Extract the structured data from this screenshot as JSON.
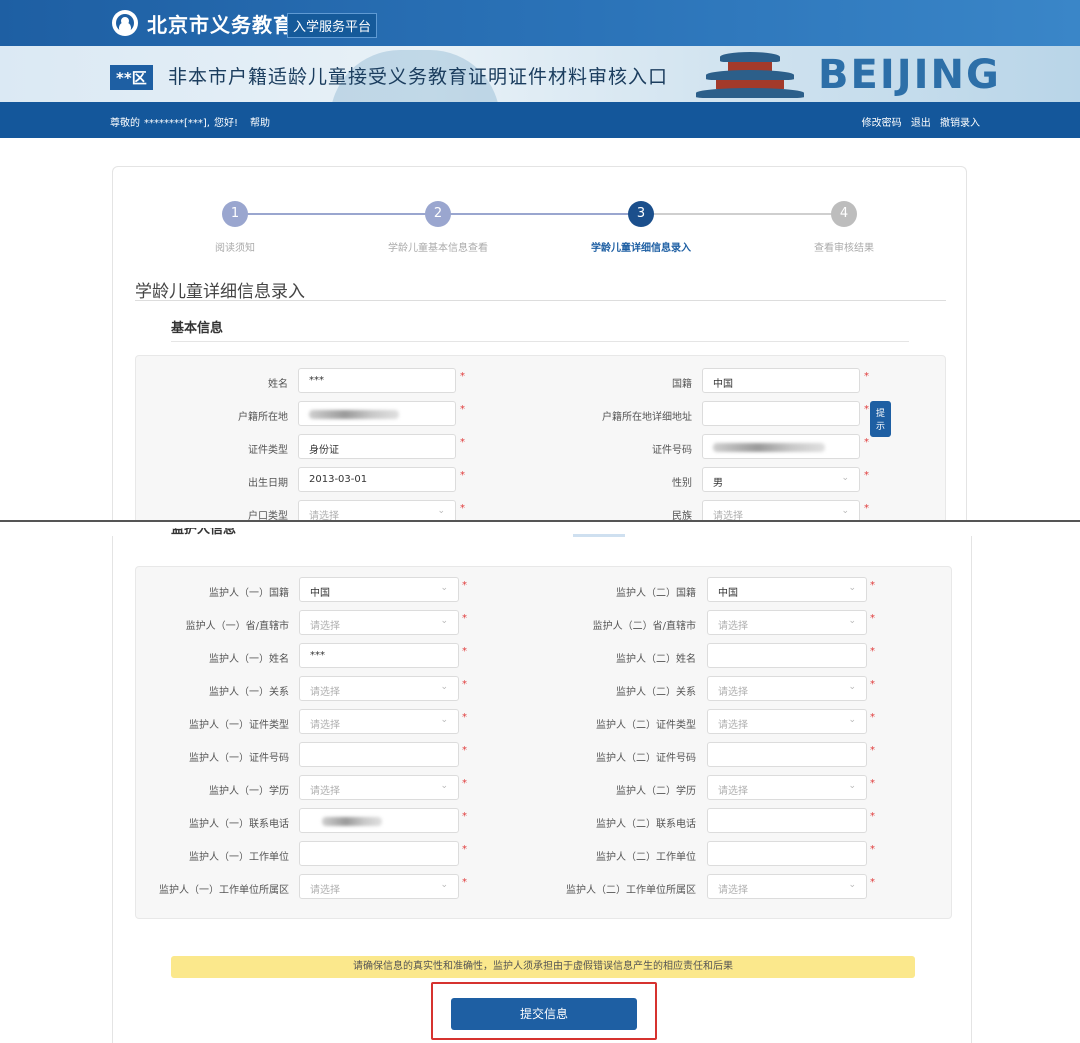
{
  "header": {
    "site_title": "北京市义务教育",
    "site_subtitle": "入学服务平台",
    "district_badge": "**区",
    "banner_title": "非本市户籍适龄儿童接受义务教育证明证件材料审核入口",
    "banner_decor_text": "BEIJING"
  },
  "nav": {
    "greeting_prefix": "尊敬的",
    "username": "********[***],",
    "greeting_suffix": "您好!",
    "help": "帮助",
    "change_password": "修改密码",
    "logout": "退出",
    "cancel_entry": "撤销录入"
  },
  "steps": [
    {
      "number": "1",
      "label": "阅读须知",
      "state": "done"
    },
    {
      "number": "2",
      "label": "学龄儿童基本信息查看",
      "state": "done"
    },
    {
      "number": "3",
      "label": "学龄儿童详细信息录入",
      "state": "active"
    },
    {
      "number": "4",
      "label": "查看审核结果",
      "state": "pending"
    }
  ],
  "colors": {
    "done": "#9aa6cf",
    "active": "#1b4f8c",
    "pending": "#bdbdbd",
    "required": "#e03b3b",
    "brand": "#1e5fa3",
    "notice_bg": "#fbe88c",
    "highlight_border": "#d6322f"
  },
  "section_title": "学龄儿童详细信息录入",
  "basic_info": {
    "title": "基本信息",
    "name": {
      "label": "姓名",
      "value": "***"
    },
    "nationality": {
      "label": "国籍",
      "value": "中国"
    },
    "hukou_location": {
      "label": "户籍所在地",
      "value": ""
    },
    "hukou_address": {
      "label": "户籍所在地详细地址",
      "value": "",
      "hint_button": "提示"
    },
    "id_type": {
      "label": "证件类型",
      "value": "身份证"
    },
    "id_number": {
      "label": "证件号码",
      "value": ""
    },
    "birth_date": {
      "label": "出生日期",
      "value": "2013-03-01"
    },
    "gender": {
      "label": "性别",
      "value": "男"
    },
    "hukou_type": {
      "label": "户口类型",
      "placeholder": "请选择"
    },
    "ethnicity": {
      "label": "民族",
      "placeholder": "请选择"
    },
    "required_mark": "*"
  },
  "guardian_info": {
    "title": "监护人信息",
    "guardian1": [
      {
        "label": "监护人（一）国籍",
        "value": "中国",
        "type": "select"
      },
      {
        "label": "监护人（一）省/直辖市",
        "placeholder": "请选择",
        "type": "select"
      },
      {
        "label": "监护人（一）姓名",
        "value": "***",
        "type": "input"
      },
      {
        "label": "监护人（一）关系",
        "placeholder": "请选择",
        "type": "select"
      },
      {
        "label": "监护人（一）证件类型",
        "placeholder": "请选择",
        "type": "select"
      },
      {
        "label": "监护人（一）证件号码",
        "value": "",
        "type": "input"
      },
      {
        "label": "监护人（一）学历",
        "placeholder": "请选择",
        "type": "select"
      },
      {
        "label": "监护人（一）联系电话",
        "value": "",
        "type": "input"
      },
      {
        "label": "监护人（一）工作单位",
        "value": "",
        "type": "input"
      },
      {
        "label": "监护人（一）工作单位所属区",
        "placeholder": "请选择",
        "type": "select"
      }
    ],
    "guardian2": [
      {
        "label": "监护人（二）国籍",
        "value": "中国",
        "type": "select"
      },
      {
        "label": "监护人（二）省/直辖市",
        "placeholder": "请选择",
        "type": "select"
      },
      {
        "label": "监护人（二）姓名",
        "value": "",
        "type": "input"
      },
      {
        "label": "监护人（二）关系",
        "placeholder": "请选择",
        "type": "select"
      },
      {
        "label": "监护人（二）证件类型",
        "placeholder": "请选择",
        "type": "select"
      },
      {
        "label": "监护人（二）证件号码",
        "value": "",
        "type": "input"
      },
      {
        "label": "监护人（二）学历",
        "placeholder": "请选择",
        "type": "select"
      },
      {
        "label": "监护人（二）联系电话",
        "value": "",
        "type": "input"
      },
      {
        "label": "监护人（二）工作单位",
        "value": "",
        "type": "input"
      },
      {
        "label": "监护人（二）工作单位所属区",
        "placeholder": "请选择",
        "type": "select"
      }
    ]
  },
  "notice": "请确保信息的真实性和准确性，监护人须承担由于虚假错误信息产生的相应责任和后果",
  "submit_label": "提交信息"
}
